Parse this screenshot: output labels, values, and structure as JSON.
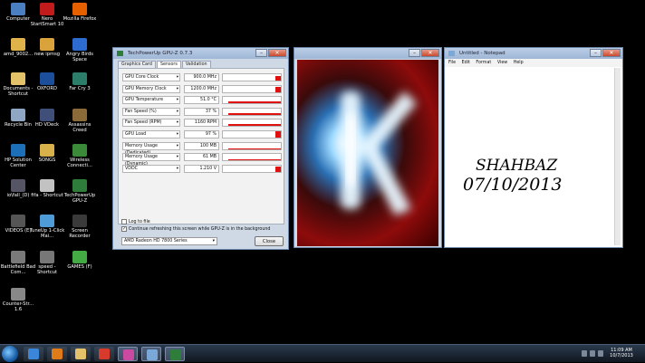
{
  "desktop": {
    "icons": [
      {
        "label": "Computer",
        "color": "#4a7fc1"
      },
      {
        "label": "Nero StartSmart 10",
        "color": "#c21b1b"
      },
      {
        "label": "Mozilla Firefox",
        "color": "#e66000"
      },
      {
        "label": "amd_9002...",
        "color": "#e0b34a"
      },
      {
        "label": "new ipmsg",
        "color": "#d9a23a"
      },
      {
        "label": "Angry Birds Space",
        "color": "#2d6bd1"
      },
      {
        "label": "Documents - Shortcut",
        "color": "#e4c26a"
      },
      {
        "label": "OXFORD",
        "color": "#1b4e9b"
      },
      {
        "label": "Far Cry 3",
        "color": "#2c7d6a"
      },
      {
        "label": "Recycle Bin",
        "color": "#8fa7c2"
      },
      {
        "label": "HD VDeck",
        "color": "#3f4f7a"
      },
      {
        "label": "Assassins Creed",
        "color": "#8b6a3a"
      },
      {
        "label": "HP Solution Center",
        "color": "#1d6fb8"
      },
      {
        "label": "SONGS",
        "color": "#d9b14a"
      },
      {
        "label": "Wireless Connecti...",
        "color": "#3a8a3a"
      },
      {
        "label": "io\\fall_(D)",
        "color": "#556"
      },
      {
        "label": "fifa - Shortcut",
        "color": "#c2c2c2"
      },
      {
        "label": "TechPowerUp GPU-Z",
        "color": "#2f7d3a"
      },
      {
        "label": "VIDEOS (E)",
        "color": "#555"
      },
      {
        "label": "TuneUp 1-Click Mai...",
        "color": "#4e9bd8"
      },
      {
        "label": "Screen Recorder",
        "color": "#3a3a3a"
      },
      {
        "label": "Battlefield Bad Com...",
        "color": "#7a7a7a"
      },
      {
        "label": "speed - Shortcut",
        "color": "#777"
      },
      {
        "label": "GAMES (F)",
        "color": "#4a4"
      },
      {
        "label": "Counter-Str... 1.6",
        "color": "#888"
      }
    ]
  },
  "gpuz": {
    "title": "TechPowerUp GPU-Z 0.7.3",
    "tabs": [
      "Graphics Card",
      "Sensors",
      "Validation"
    ],
    "active_tab": "Sensors",
    "sensors": [
      {
        "name": "GPU Core Clock",
        "value": "900.0 MHz",
        "level": 0.65
      },
      {
        "name": "GPU Memory Clock",
        "value": "1200.0 MHz",
        "level": 0.7
      },
      {
        "name": "GPU Temperature",
        "value": "51.0 °C",
        "level": 0.3
      },
      {
        "name": "Fan Speed (%)",
        "value": "37 %",
        "level": 0.35
      },
      {
        "name": "Fan Speed (RPM)",
        "value": "1160 RPM",
        "level": 0.35
      },
      {
        "name": "GPU Load",
        "value": "97 %",
        "level": 0.9
      },
      {
        "name": "Memory Usage (Dedicated)",
        "value": "100 MB",
        "level": 0.1
      },
      {
        "name": "Memory Usage (Dynamic)",
        "value": "61 MB",
        "level": 0.08
      },
      {
        "name": "VDDC",
        "value": "1.210 V",
        "level": 0.75
      }
    ],
    "log_to_file": "Log to file",
    "continue_refresh": "Continue refreshing this screen while GPU-Z is in the background",
    "card_select": "AMD Radeon HD 7800 Series",
    "close_label": "Close"
  },
  "notepad": {
    "title": "Untitled - Notepad",
    "menu": [
      "File",
      "Edit",
      "Format",
      "View",
      "Help"
    ],
    "line1": "SHAHBAZ",
    "line2": "07/10/2013"
  },
  "taskbar": {
    "time": "11:09 AM",
    "date": "10/7/2013",
    "apps": [
      {
        "name": "ie-icon",
        "color": "#3a86d8"
      },
      {
        "name": "media-player-icon",
        "color": "#e07b1a"
      },
      {
        "name": "explorer-icon",
        "color": "#e4c26a"
      },
      {
        "name": "chrome-icon",
        "color": "#d83b2b"
      },
      {
        "name": "paint-icon",
        "color": "#c94aa0"
      },
      {
        "name": "notepad-icon",
        "color": "#7aa8d8"
      },
      {
        "name": "gpuz-icon",
        "color": "#2f7d3a"
      }
    ]
  }
}
